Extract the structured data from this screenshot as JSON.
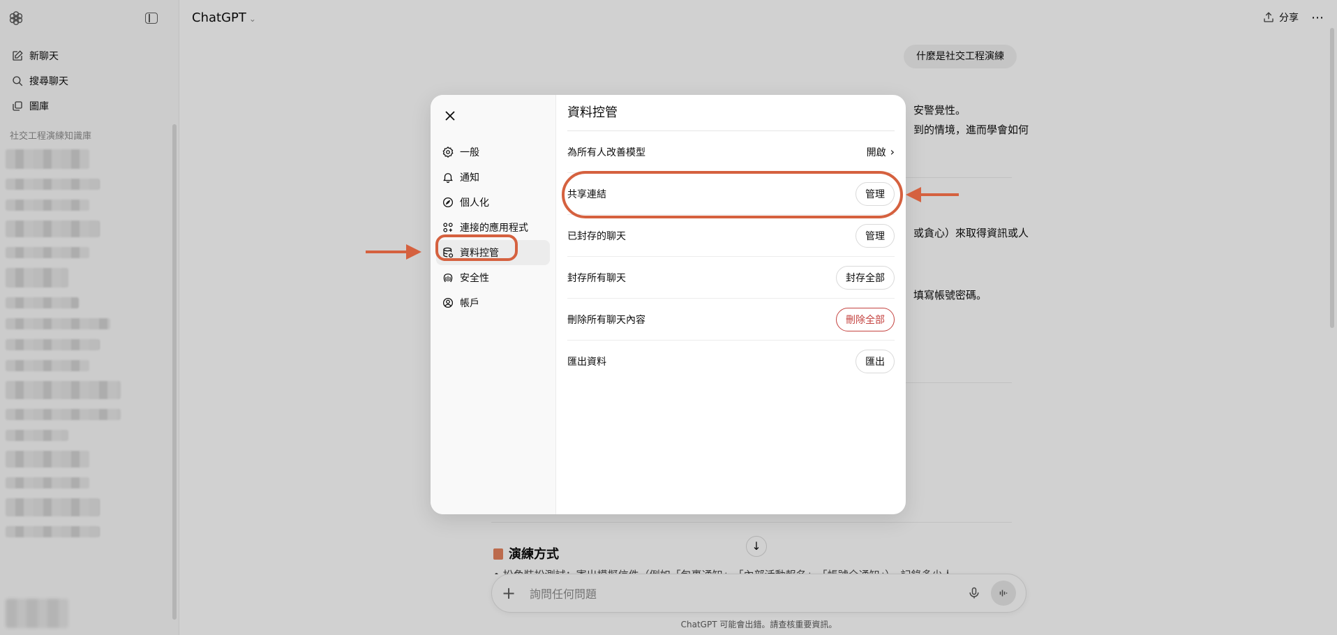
{
  "sidebar": {
    "nav": [
      {
        "label": "新聊天",
        "icon": "edit-icon"
      },
      {
        "label": "搜尋聊天",
        "icon": "search-icon"
      },
      {
        "label": "圖庫",
        "icon": "library-icon"
      }
    ],
    "section_title": "社交工程演練知識庫"
  },
  "header": {
    "model": "ChatGPT",
    "share_label": "分享"
  },
  "conversation": {
    "user_message": "什麼是社交工程演練",
    "snippets": [
      "安警覺性。",
      "到的情境，進而學會如何",
      "或貪心）來取得資訊或人",
      "填寫帳號密碼。"
    ],
    "heading": "演練方式",
    "partial_line": "• 扮角裝扮測試：寄出模擬信件（例如「包裹通知」、「內部活動報名」、「帳號全通知」）、記錄多少人"
  },
  "composer": {
    "placeholder": "詢問任何問題",
    "disclaimer": "ChatGPT 可能會出錯。請查核重要資訊。"
  },
  "settings": {
    "title": "資料控管",
    "nav": [
      {
        "label": "一般",
        "icon": "gear-icon"
      },
      {
        "label": "通知",
        "icon": "bell-icon"
      },
      {
        "label": "個人化",
        "icon": "personalization-icon"
      },
      {
        "label": "連接的應用程式",
        "icon": "apps-icon"
      },
      {
        "label": "資料控管",
        "icon": "database-icon",
        "active": true
      },
      {
        "label": "安全性",
        "icon": "shield-icon"
      },
      {
        "label": "帳戶",
        "icon": "account-icon"
      }
    ],
    "rows": [
      {
        "label": "為所有人改善模型",
        "action": "開啟",
        "type": "link"
      },
      {
        "label": "共享連結",
        "action": "管理",
        "type": "button"
      },
      {
        "label": "已封存的聊天",
        "action": "管理",
        "type": "button"
      },
      {
        "label": "封存所有聊天",
        "action": "封存全部",
        "type": "button"
      },
      {
        "label": "刪除所有聊天內容",
        "action": "刪除全部",
        "type": "danger"
      },
      {
        "label": "匯出資料",
        "action": "匯出",
        "type": "button"
      }
    ]
  },
  "colors": {
    "annotation": "#d5613f",
    "danger": "#c4423f"
  }
}
